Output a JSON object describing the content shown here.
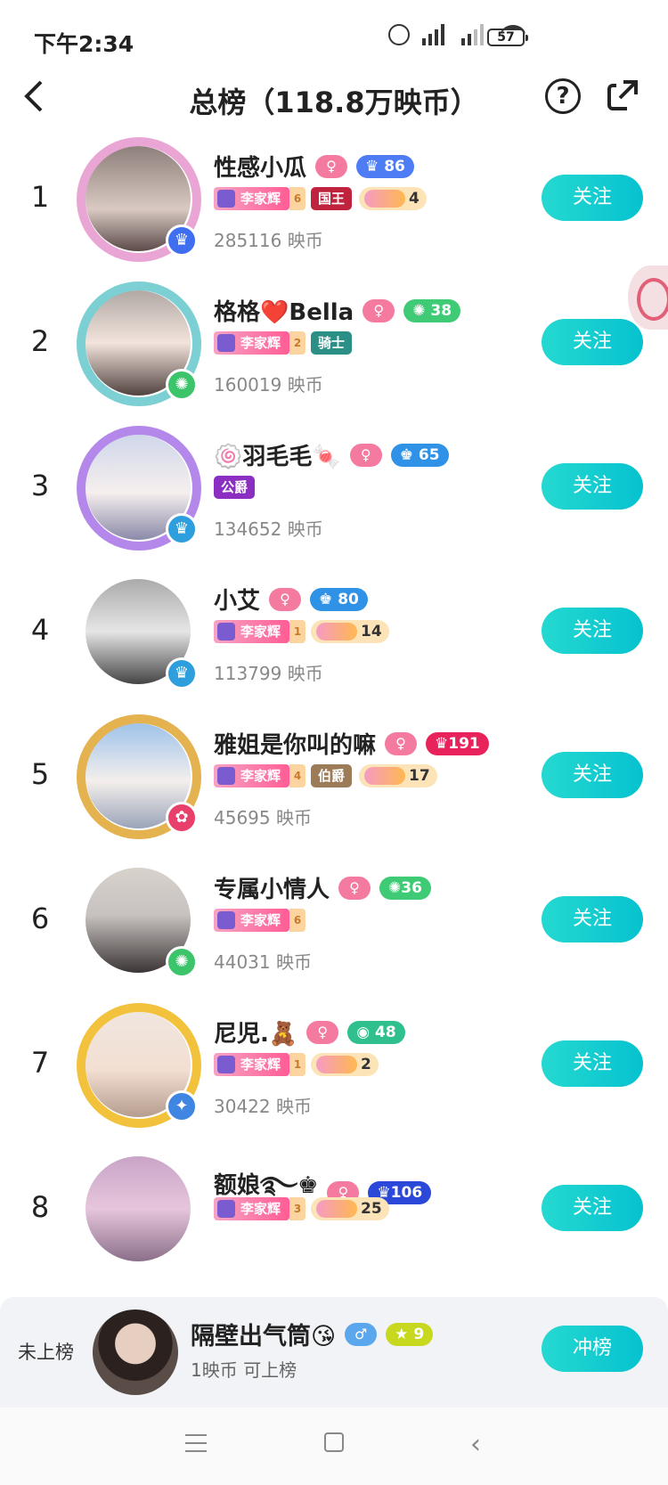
{
  "status": {
    "time": "下午2:34",
    "battery": "57"
  },
  "header": {
    "title": "总榜（118.8万映币）"
  },
  "colors": {
    "accent": "#10c9cf",
    "pink": "#f47aa0"
  },
  "rows": [
    {
      "rank": "1",
      "name": "性感小瓜",
      "level": "86",
      "guard": "李家辉",
      "guard_lv": "6",
      "title_medal": "国王",
      "gift_count": "4",
      "coins": "285116 映币",
      "follow": "关注"
    },
    {
      "rank": "2",
      "name": "格格❤️Bella",
      "level": "38",
      "guard": "李家辉",
      "guard_lv": "2",
      "title_medal": "骑士",
      "coins": "160019 映币",
      "follow": "关注"
    },
    {
      "rank": "3",
      "name": "🍥羽毛毛🍬",
      "level": "65",
      "title_medal": "公爵",
      "coins": "134652 映币",
      "follow": "关注"
    },
    {
      "rank": "4",
      "name": "小艾",
      "level": "80",
      "guard": "李家辉",
      "guard_lv": "1",
      "gift_count": "14",
      "coins": "113799 映币",
      "follow": "关注"
    },
    {
      "rank": "5",
      "name": "雅姐是你叫的嘛",
      "level": "191",
      "guard": "李家辉",
      "guard_lv": "4",
      "title_medal": "伯爵",
      "gift_count": "17",
      "coins": "45695 映币",
      "follow": "关注"
    },
    {
      "rank": "6",
      "name": "专属小情人",
      "level": "36",
      "guard": "李家辉",
      "guard_lv": "6",
      "coins": "44031 映币",
      "follow": "关注"
    },
    {
      "rank": "7",
      "name": "尼児.🧸",
      "level": "48",
      "guard": "李家辉",
      "guard_lv": "1",
      "gift_count": "2",
      "coins": "30422 映币",
      "follow": "关注"
    },
    {
      "rank": "8",
      "name": "额娘࿐♚",
      "level": "106",
      "guard": "李家辉",
      "guard_lv": "3",
      "gift_count": "25",
      "coins": "",
      "follow": "关注"
    }
  ],
  "footer": {
    "label": "未上榜",
    "name": "隔壁出气筒😘",
    "level": "9",
    "sub": "1映币 可上榜",
    "button": "冲榜"
  }
}
